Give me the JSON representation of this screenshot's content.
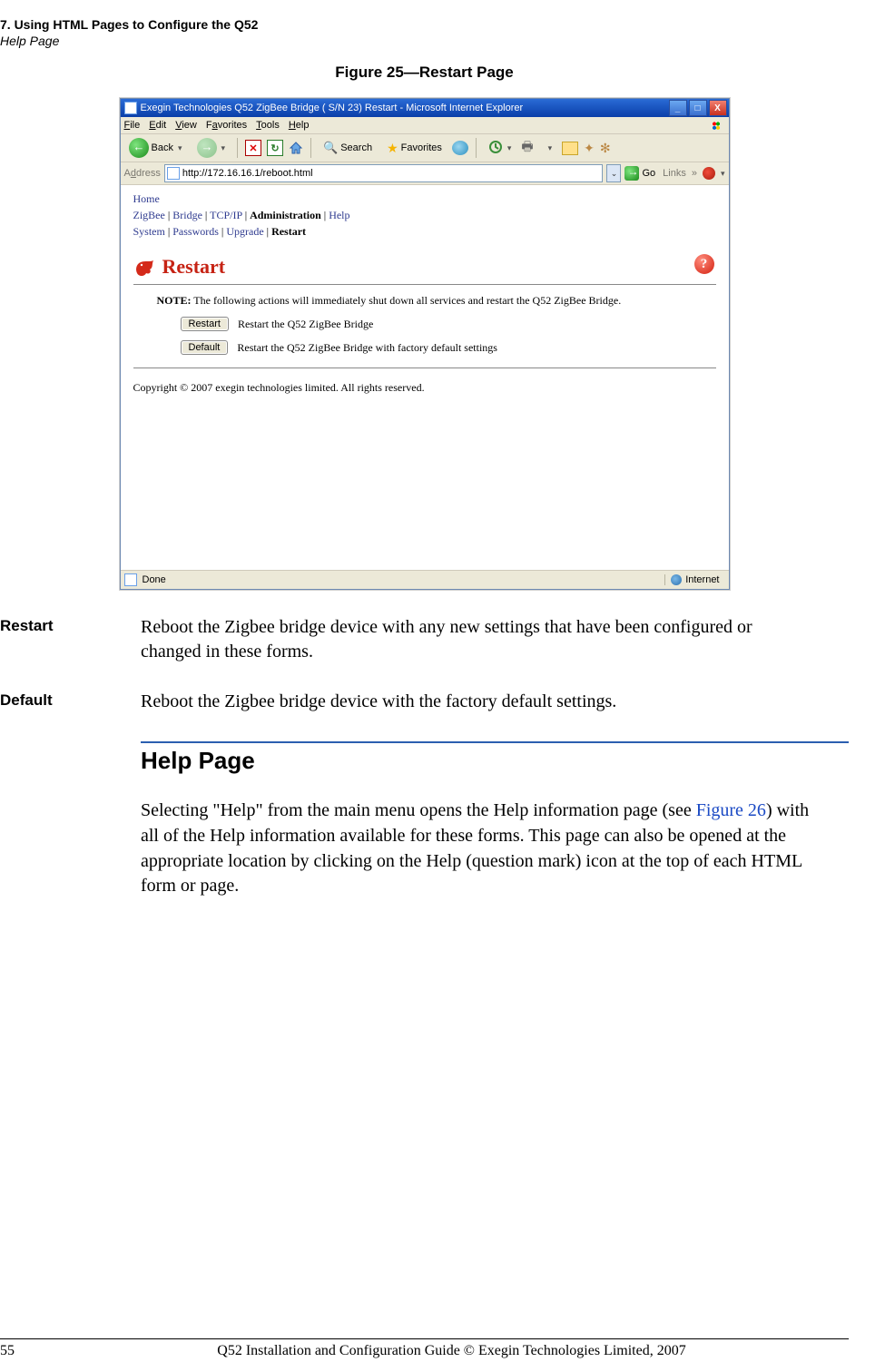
{
  "header": {
    "line1": "7. Using HTML Pages to Configure the Q52",
    "line2": "Help Page"
  },
  "figure_caption": "Figure 25—Restart Page",
  "ss": {
    "title": "Exegin Technologies Q52 ZigBee Bridge ( S/N 23) Restart - Microsoft Internet Explorer",
    "menu": {
      "file": "File",
      "edit": "Edit",
      "view": "View",
      "favorites": "Favorites",
      "tools": "Tools",
      "help": "Help"
    },
    "toolbar": {
      "back": "Back",
      "search": "Search",
      "favorites": "Favorites"
    },
    "address_label": "Address",
    "url": "http://172.16.16.1/reboot.html",
    "go": "Go",
    "links": "Links",
    "nav_home": "Home",
    "nav_line1": {
      "zigbee": "ZigBee",
      "bridge": "Bridge",
      "tcpip": "TCP/IP",
      "admin": "Administration",
      "help": "Help"
    },
    "nav_line2": {
      "system": "System",
      "passwords": "Passwords",
      "upgrade": "Upgrade",
      "restart": "Restart"
    },
    "restart_heading": "Restart",
    "help_icon_text": "?",
    "note_label": "NOTE:",
    "note_text": " The following actions will immediately shut down all services and restart the Q52 ZigBee Bridge.",
    "btn_restart": "Restart",
    "btn_restart_desc": "Restart the Q52 ZigBee Bridge",
    "btn_default": "Default",
    "btn_default_desc": "Restart the Q52 ZigBee Bridge with factory default settings",
    "copyright": "Copyright © 2007 exegin technologies limited. All rights reserved.",
    "status_done": "Done",
    "status_zone": "Internet"
  },
  "defs": {
    "restart_term": "Restart",
    "restart_body": "Reboot the Zigbee bridge device with any new settings that have been configured or changed in these forms.",
    "default_term": "Default",
    "default_body": "Reboot the Zigbee bridge device with the factory default settings."
  },
  "section_title": "Help Page",
  "paragraph_pre": "Selecting \"Help\" from the main menu opens the Help information page (see ",
  "paragraph_link": "Figure 26",
  "paragraph_post": ") with all of the Help information available for these forms. This page can also be opened at the appropriate location by clicking on the Help (question mark) icon at the top of each HTML form or page.",
  "footer": {
    "page": "55",
    "text": "Q52 Installation and Configuration Guide  © Exegin Technologies Limited, 2007"
  }
}
